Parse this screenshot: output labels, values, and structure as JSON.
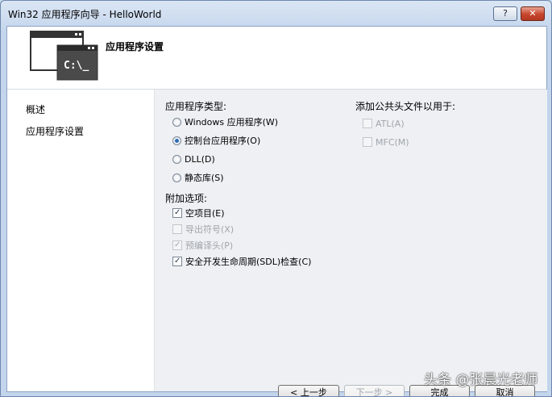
{
  "window": {
    "title": "Win32 应用程序向导 - HelloWorld",
    "help_label": "?",
    "close_label": "✕"
  },
  "header": {
    "title": "应用程序设置",
    "icon_text": "C:\\_"
  },
  "nav": {
    "items": [
      {
        "label": "概述"
      },
      {
        "label": "应用程序设置"
      }
    ]
  },
  "app_type": {
    "label": "应用程序类型:",
    "options": [
      {
        "label": "Windows 应用程序(W)",
        "selected": false
      },
      {
        "label": "控制台应用程序(O)",
        "selected": true
      },
      {
        "label": "DLL(D)",
        "selected": false
      },
      {
        "label": "静态库(S)",
        "selected": false
      }
    ]
  },
  "extra_options": {
    "label": "附加选项:",
    "items": [
      {
        "label": "空项目(E)",
        "checked": true,
        "enabled": true
      },
      {
        "label": "导出符号(X)",
        "checked": false,
        "enabled": false
      },
      {
        "label": "预编译头(P)",
        "checked": true,
        "enabled": false
      },
      {
        "label": "安全开发生命周期(SDL)检查(C)",
        "checked": true,
        "enabled": true
      }
    ]
  },
  "common_headers": {
    "label": "添加公共头文件以用于:",
    "items": [
      {
        "label": "ATL(A)",
        "checked": false,
        "enabled": false
      },
      {
        "label": "MFC(M)",
        "checked": false,
        "enabled": false
      }
    ]
  },
  "buttons": {
    "prev": "< 上一步",
    "next": "下一步 >",
    "finish": "完成",
    "cancel": "取消"
  },
  "watermark": "头条 @张晨光老师"
}
